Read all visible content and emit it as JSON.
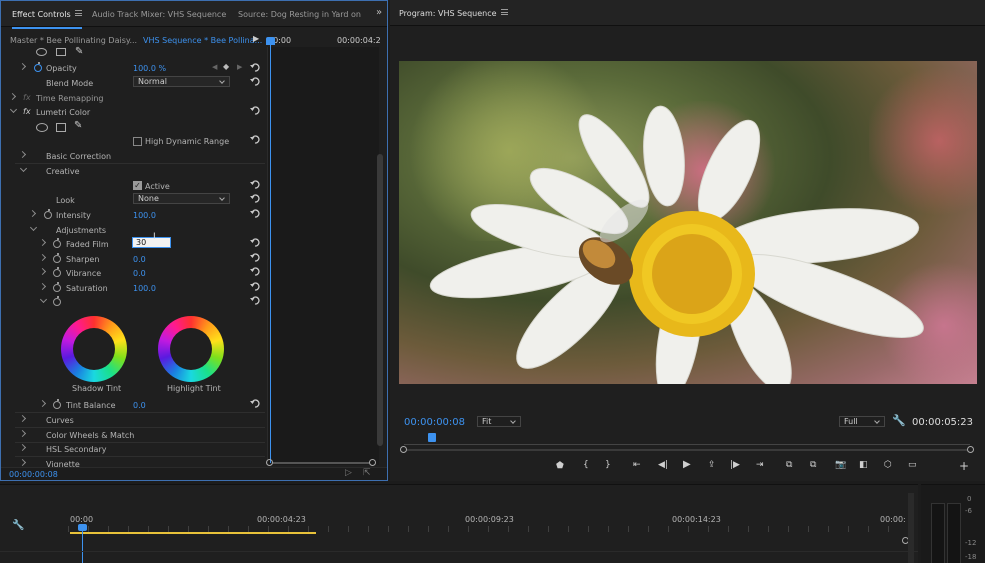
{
  "tabs": {
    "effect_controls": "Effect Controls",
    "audio_mixer": "Audio Track Mixer: VHS Sequence",
    "source": "Source: Dog Resting in Yard on Sunr",
    "program": "Program: VHS Sequence"
  },
  "effect_controls": {
    "master_label": "Master * Bee Pollinating Daisy...",
    "sequence_label": "VHS Sequence * Bee Pollina...",
    "timeline_start": "00:00",
    "timeline_end": "00:00:04:2",
    "opacity": {
      "label": "Opacity",
      "value": "100.0 %"
    },
    "blend_mode": {
      "label": "Blend Mode",
      "value": "Normal"
    },
    "time_remapping": "Time Remapping",
    "lumetri": "Lumetri Color",
    "hdr": "High Dynamic Range",
    "basic_correction": "Basic Correction",
    "creative": "Creative",
    "active": "Active",
    "look": {
      "label": "Look",
      "value": "None"
    },
    "intensity": {
      "label": "Intensity",
      "value": "100.0"
    },
    "adjustments": "Adjustments",
    "faded_film": {
      "label": "Faded Film",
      "value": "30"
    },
    "sharpen": {
      "label": "Sharpen",
      "value": "0.0"
    },
    "vibrance": {
      "label": "Vibrance",
      "value": "0.0"
    },
    "saturation": {
      "label": "Saturation",
      "value": "100.0"
    },
    "shadow_tint": "Shadow Tint",
    "highlight_tint": "Highlight Tint",
    "tint_balance": {
      "label": "Tint Balance",
      "value": "0.0"
    },
    "curves": "Curves",
    "color_wheels": "Color Wheels & Match",
    "hsl": "HSL Secondary",
    "vignette": "Vignette",
    "bottom_timecode": "00:00:00:08"
  },
  "program": {
    "timecode": "00:00:00:08",
    "fit": "Fit",
    "quality": "Full",
    "duration": "00:00:05:23"
  },
  "timeline": {
    "ticks": [
      "00:00",
      "00:00:04:23",
      "00:00:09:23",
      "00:00:14:23",
      "00:00:"
    ],
    "meter": [
      "-6",
      "-12",
      "-18"
    ],
    "meter_top": "0"
  },
  "colors": {
    "accent": "#3d92ef",
    "panel": "#1f1f1f",
    "work_area": "#e8c23a"
  }
}
